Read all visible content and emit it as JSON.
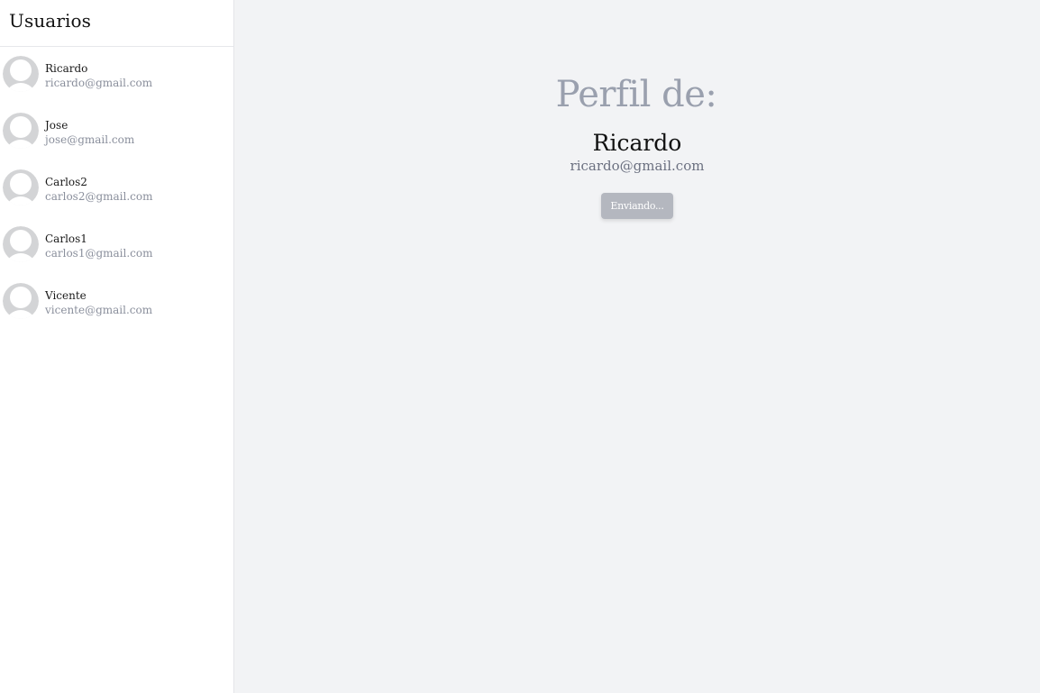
{
  "sidebar": {
    "title": "Usuarios",
    "users": [
      {
        "name": "Ricardo",
        "email": "ricardo@gmail.com",
        "avatar_icon": "default-avatar-icon"
      },
      {
        "name": "Jose",
        "email": "jose@gmail.com",
        "avatar_icon": "default-avatar-icon"
      },
      {
        "name": "Carlos2",
        "email": "carlos2@gmail.com",
        "avatar_icon": "default-avatar-icon"
      },
      {
        "name": "Carlos1",
        "email": "carlos1@gmail.com",
        "avatar_icon": "default-avatar-icon"
      },
      {
        "name": "Vicente",
        "email": "vicente@gmail.com",
        "avatar_icon": "default-avatar-icon"
      }
    ]
  },
  "profile": {
    "heading": "Perfil de:",
    "name": "Ricardo",
    "email": "ricardo@gmail.com",
    "button_label": "Enviando..."
  },
  "colors": {
    "sidebar_bg": "#ffffff",
    "main_bg": "#f2f3f5",
    "heading": "#9aa0ae",
    "button_disabled": "#b4b7bf",
    "avatar": "#d3d4d6"
  }
}
